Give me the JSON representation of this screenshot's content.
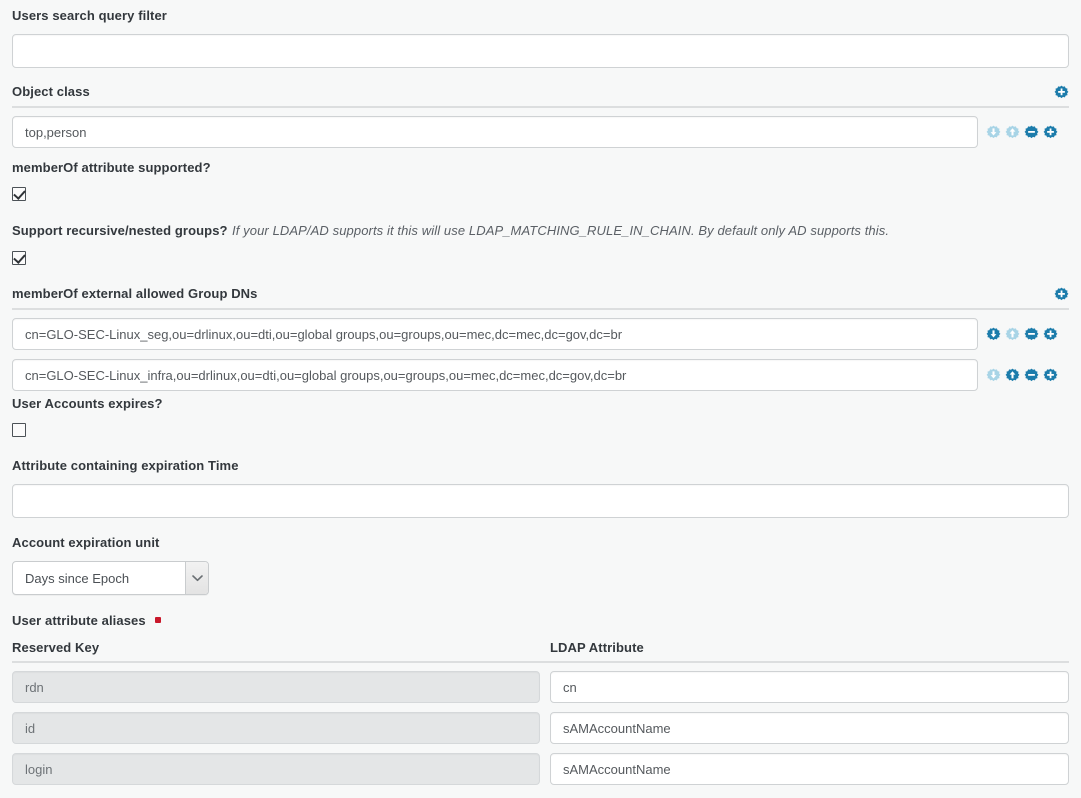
{
  "form": {
    "users_search_query_filter": {
      "label": "Users search query filter",
      "value": "",
      "placeholder": ""
    },
    "object_class": {
      "label": "Object class",
      "add_icon": "plus-circle-icon",
      "rows": [
        {
          "value": "top,person",
          "placeholder": "",
          "actions": [
            {
              "icon": "arrow-down-circle-icon",
              "state": "disabled"
            },
            {
              "icon": "arrow-up-circle-icon",
              "state": "disabled"
            },
            {
              "icon": "minus-circle-icon",
              "state": "enabled"
            },
            {
              "icon": "plus-circle-icon",
              "state": "enabled"
            }
          ]
        }
      ]
    },
    "memberof_attribute_supported": {
      "label": "memberOf attribute supported?",
      "checked": true
    },
    "support_recursive_nested_groups": {
      "label": "Support recursive/nested groups?",
      "hint": "If your LDAP/AD supports it this will use LDAP_MATCHING_RULE_IN_CHAIN. By default only AD supports this.",
      "checked": true
    },
    "memberof_external_allowed_group_dns": {
      "label": "memberOf external allowed Group DNs",
      "add_icon": "plus-circle-icon",
      "rows": [
        {
          "value": "cn=GLO-SEC-Linux_seg,ou=drlinux,ou=dti,ou=global groups,ou=groups,ou=mec,dc=mec,dc=gov,dc=br",
          "actions": [
            {
              "icon": "arrow-down-circle-icon",
              "state": "enabled"
            },
            {
              "icon": "arrow-up-circle-icon",
              "state": "disabled"
            },
            {
              "icon": "minus-circle-icon",
              "state": "enabled"
            },
            {
              "icon": "plus-circle-icon",
              "state": "enabled"
            }
          ]
        },
        {
          "value": "cn=GLO-SEC-Linux_infra,ou=drlinux,ou=dti,ou=global groups,ou=groups,ou=mec,dc=mec,dc=gov,dc=br",
          "actions": [
            {
              "icon": "arrow-down-circle-icon",
              "state": "disabled"
            },
            {
              "icon": "arrow-up-circle-icon",
              "state": "enabled"
            },
            {
              "icon": "minus-circle-icon",
              "state": "enabled"
            },
            {
              "icon": "plus-circle-icon",
              "state": "enabled"
            }
          ]
        }
      ]
    },
    "user_accounts_expires": {
      "label": "User Accounts expires?",
      "checked": false
    },
    "attribute_containing_expiration_time": {
      "label": "Attribute containing expiration Time",
      "value": "",
      "placeholder": ""
    },
    "account_expiration_unit": {
      "label": "Account expiration unit",
      "selected": "Days since Epoch",
      "chevron_icon": "chevron-down-icon"
    },
    "user_attribute_aliases": {
      "label": "User attribute aliases",
      "required_marker": true,
      "columns": [
        "Reserved Key",
        "LDAP Attribute"
      ],
      "rows": [
        {
          "reserved_key": "rdn",
          "ldap_attribute": "cn"
        },
        {
          "reserved_key": "id",
          "ldap_attribute": "sAMAccountName"
        },
        {
          "reserved_key": "login",
          "ldap_attribute": "sAMAccountName"
        }
      ]
    }
  },
  "colors": {
    "icon_enabled": "#1c7cab",
    "icon_disabled": "#a8d4e6",
    "required_marker": "#c9182b",
    "page_background": "#f7f8f8",
    "separator": "#dcdedf"
  }
}
